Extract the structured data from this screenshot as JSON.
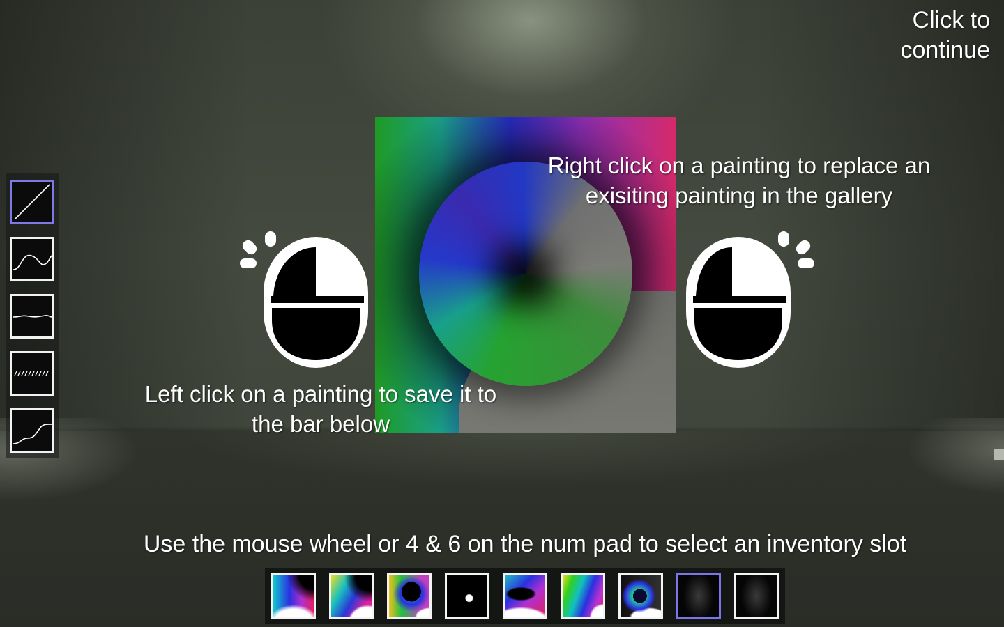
{
  "hud": {
    "continue_label": "Click to continue",
    "right_click_hint": "Right click on a painting to replace an exisiting painting in the gallery",
    "left_click_hint": "Left click on a painting to save it to the bar below",
    "wheel_hint": "Use the mouse wheel or 4 & 6 on the num pad to select an inventory slot"
  },
  "tools": [
    {
      "name": "linear-curve-icon",
      "selected": true
    },
    {
      "name": "sine-curve-icon",
      "selected": false
    },
    {
      "name": "flat-wave-icon",
      "selected": false
    },
    {
      "name": "noise-icon",
      "selected": false
    },
    {
      "name": "step-curve-icon",
      "selected": false
    }
  ],
  "inventory": {
    "slot_count": 9,
    "selected_slot": 8,
    "filled_slots": 7
  },
  "colors": {
    "selection_accent": "#7d79e6",
    "slot_border": "#f4f4f4",
    "text": "#ffffff"
  }
}
